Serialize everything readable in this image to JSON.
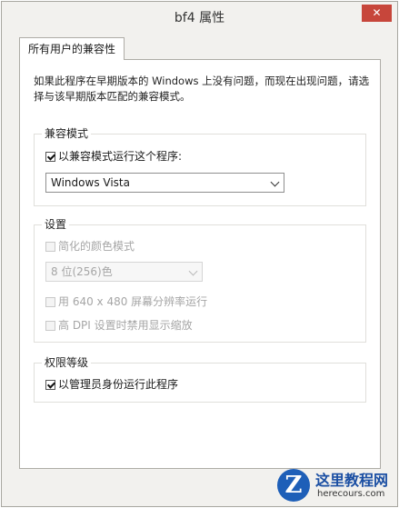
{
  "window": {
    "title": "bf4 属性",
    "close_glyph": "✕"
  },
  "tabs": [
    {
      "label": "所有用户的兼容性",
      "active": true
    }
  ],
  "intro": "如果此程序在早期版本的 Windows 上没有问题，而现在出现问题，请选择与该早期版本匹配的兼容模式。",
  "compat_mode": {
    "label": "兼容模式",
    "checkbox": {
      "label": "以兼容模式运行这个程序:",
      "checked": true
    },
    "select": {
      "value": "Windows Vista",
      "icon": "chevron-down-icon"
    }
  },
  "settings": {
    "label": "设置",
    "reduced_color": {
      "label": "简化的颜色模式",
      "checked": false,
      "enabled": false
    },
    "color_select": {
      "value": "8 位(256)色",
      "enabled": false
    },
    "resolution": {
      "label": "用 640 x 480 屏幕分辨率运行",
      "checked": false,
      "enabled": false
    },
    "dpi": {
      "label": "高 DPI 设置时禁用显示缩放",
      "checked": false,
      "enabled": false
    }
  },
  "privilege": {
    "label": "权限等级",
    "run_as_admin": {
      "label": "以管理员身份运行此程序",
      "checked": true
    }
  },
  "watermark": {
    "title": "这里教程网",
    "url": "herecours.com",
    "logo_letter": "Z"
  },
  "colors": {
    "close_button": "#c7463b",
    "watermark_blue": "#1e5fb8"
  }
}
